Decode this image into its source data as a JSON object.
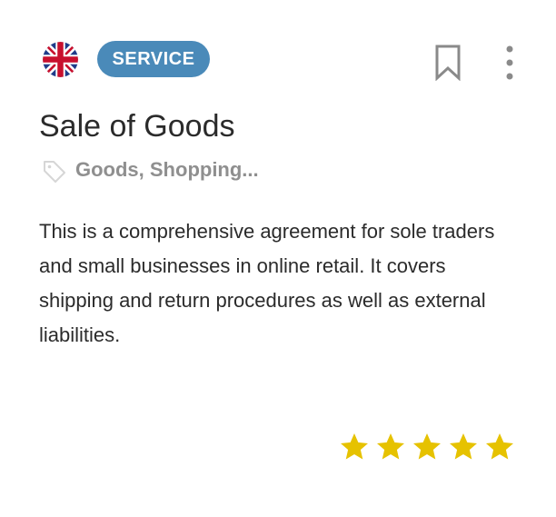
{
  "card": {
    "flag_icon": "uk-flag-icon",
    "badge_label": "SERVICE",
    "bookmark_icon": "bookmark-icon",
    "more_icon": "more-vertical-icon",
    "title": "Sale of Goods",
    "tag_icon": "tag-icon",
    "tags_text": "Goods, Shopping...",
    "description": "This is a comprehensive agreement for sole traders and small businesses in online retail. It covers shipping and return procedures as well as external liabilities.",
    "rating": {
      "value": 5,
      "max": 5,
      "star_icon": "star-icon"
    }
  },
  "colors": {
    "badge_background": "#4a8ab9",
    "badge_text": "#ffffff",
    "title_text": "#2b2b2b",
    "tags_text": "#8f8f8f",
    "icon_gray": "#8a8a8a",
    "star_gold": "#e6c200"
  }
}
